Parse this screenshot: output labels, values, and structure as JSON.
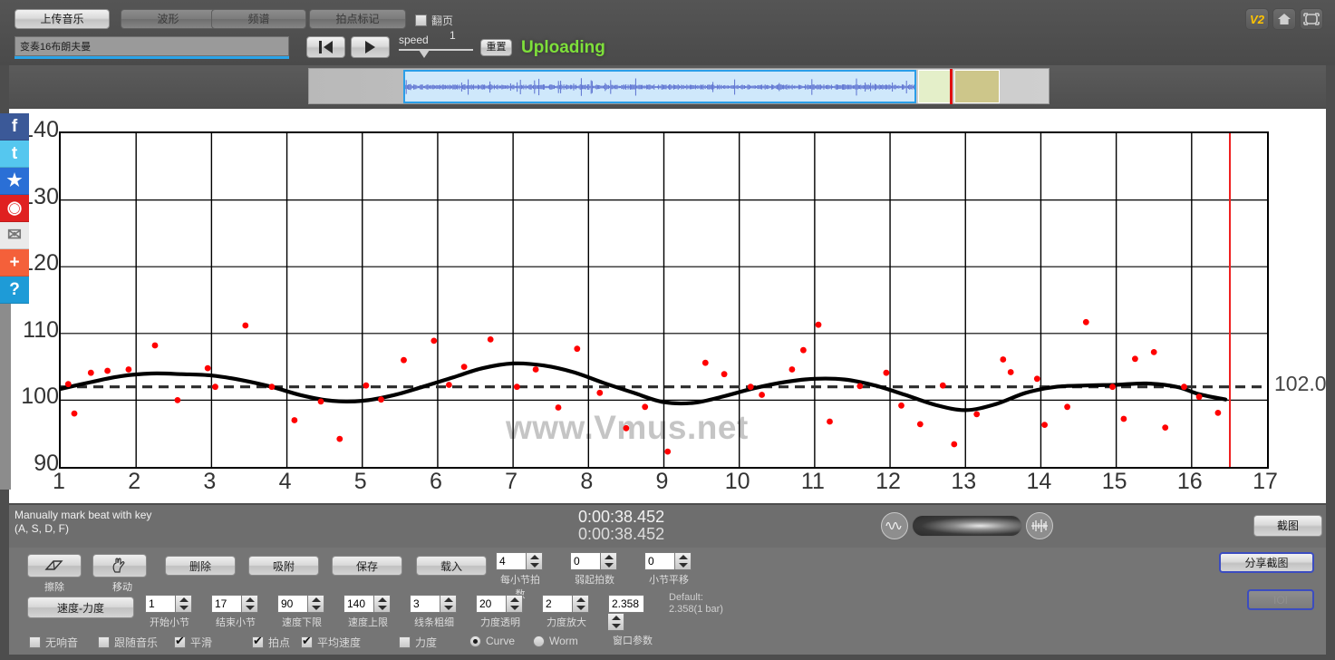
{
  "toolbar": {
    "upload_music": "上传音乐",
    "waveform": "波形",
    "spectrum": "频谱",
    "beat_mark": "拍点标记",
    "page_turn_label": "翻页",
    "page_turn_checked": false,
    "track_title": "变奏16布朗夫曼",
    "speed_label": "speed",
    "speed_value": "1",
    "reset": "重置",
    "status": "Uploading",
    "status_color": "#7ee03a",
    "version_badge": "V2",
    "home_icon": "home-icon",
    "fullscreen_icon": "fullscreen-icon"
  },
  "social": [
    {
      "name": "facebook-icon",
      "glyph": "f",
      "color": "#3b5998"
    },
    {
      "name": "twitter-icon",
      "glyph": "t",
      "color": "#55c7ef"
    },
    {
      "name": "qzone-icon",
      "glyph": "★",
      "color": "#2a6fd6"
    },
    {
      "name": "weibo-icon",
      "glyph": "◉",
      "color": "#e02020"
    },
    {
      "name": "email-icon",
      "glyph": "✉",
      "color": "#eaeaea"
    },
    {
      "name": "more-share-icon",
      "glyph": "+",
      "color": "#f4603a"
    },
    {
      "name": "help-icon",
      "glyph": "?",
      "color": "#1e9bd7"
    }
  ],
  "status_bar": {
    "hint_line1": "Manually mark beat with key",
    "hint_line2": "(A, S, D, F)",
    "time_current": "0:00:38.452",
    "time_total": "0:00:38.452",
    "screenshot": "截图"
  },
  "tools": {
    "erase": "擦除",
    "move": "移动",
    "delete": "删除",
    "snap": "吸附",
    "save": "保存",
    "load": "载入",
    "tempo_dynamics": "速度-力度",
    "share_screenshot": "分享截图",
    "ioi": "IOI"
  },
  "spinners_row1": [
    {
      "label": "每小节拍数",
      "value": "4"
    },
    {
      "label": "弱起拍数",
      "value": "0"
    },
    {
      "label": "小节平移",
      "value": "0"
    }
  ],
  "spinners_row2": [
    {
      "label": "开始小节",
      "value": "1"
    },
    {
      "label": "结束小节",
      "value": "17"
    },
    {
      "label": "速度下限",
      "value": "90"
    },
    {
      "label": "速度上限",
      "value": "140"
    },
    {
      "label": "线条粗细",
      "value": "3"
    },
    {
      "label": "力度透明",
      "value": "20"
    },
    {
      "label": "力度放大",
      "value": "2"
    },
    {
      "label": "窗口参数",
      "value": "2.358"
    }
  ],
  "default_note": {
    "line1": "Default:",
    "line2": "2.358(1 bar)"
  },
  "checkboxes": [
    {
      "label": "无响音",
      "checked": false
    },
    {
      "label": "跟随音乐",
      "checked": false
    },
    {
      "label": "平滑",
      "checked": true
    },
    {
      "label": "拍点",
      "checked": true
    },
    {
      "label": "平均速度",
      "checked": true
    },
    {
      "label": "力度",
      "checked": false
    }
  ],
  "radios": [
    {
      "label": "Curve",
      "selected": true
    },
    {
      "label": "Worm",
      "selected": false
    }
  ],
  "watermark": "www.Vmus.net",
  "chart_data": {
    "type": "scatter",
    "title": "",
    "xlabel": "",
    "ylabel": "",
    "xlim": [
      1,
      17
    ],
    "ylim": [
      90,
      140
    ],
    "xticks": [
      1,
      2,
      3,
      4,
      5,
      6,
      7,
      8,
      9,
      10,
      11,
      12,
      13,
      14,
      15,
      16,
      17
    ],
    "yticks": [
      90,
      100,
      110,
      120,
      130,
      140
    ],
    "grid": true,
    "average_line": {
      "value": 102.0,
      "label": "102.0",
      "style": "dashed"
    },
    "cursor_x": 16.5,
    "point_color": "#ff0000",
    "curve_color": "#000000",
    "series": [
      {
        "name": "beat tempo points",
        "type": "scatter",
        "points": [
          [
            1.1,
            102.4
          ],
          [
            1.18,
            98.0
          ],
          [
            1.4,
            104.1
          ],
          [
            1.62,
            104.4
          ],
          [
            1.9,
            104.6
          ],
          [
            2.25,
            108.2
          ],
          [
            2.55,
            100.0
          ],
          [
            2.95,
            104.8
          ],
          [
            3.05,
            102.0
          ],
          [
            3.45,
            111.2
          ],
          [
            3.8,
            102.0
          ],
          [
            4.1,
            97.0
          ],
          [
            4.45,
            99.8
          ],
          [
            4.7,
            94.2
          ],
          [
            5.05,
            102.2
          ],
          [
            5.25,
            100.1
          ],
          [
            5.55,
            106.0
          ],
          [
            5.95,
            108.9
          ],
          [
            6.15,
            102.3
          ],
          [
            6.35,
            105.0
          ],
          [
            6.7,
            109.1
          ],
          [
            7.05,
            102.0
          ],
          [
            7.3,
            104.6
          ],
          [
            7.6,
            98.9
          ],
          [
            7.85,
            107.7
          ],
          [
            8.15,
            101.1
          ],
          [
            8.5,
            95.8
          ],
          [
            8.75,
            99.0
          ],
          [
            9.05,
            92.3
          ],
          [
            9.55,
            105.6
          ],
          [
            9.8,
            103.9
          ],
          [
            10.15,
            102.0
          ],
          [
            10.3,
            100.8
          ],
          [
            10.7,
            104.6
          ],
          [
            10.85,
            107.5
          ],
          [
            11.05,
            111.3
          ],
          [
            11.2,
            96.8
          ],
          [
            11.6,
            102.1
          ],
          [
            11.95,
            104.1
          ],
          [
            12.15,
            99.2
          ],
          [
            12.4,
            96.4
          ],
          [
            12.7,
            102.2
          ],
          [
            12.85,
            93.4
          ],
          [
            13.15,
            97.9
          ],
          [
            13.5,
            106.1
          ],
          [
            13.6,
            104.2
          ],
          [
            13.95,
            103.2
          ],
          [
            14.05,
            96.3
          ],
          [
            14.35,
            99.0
          ],
          [
            14.6,
            111.7
          ],
          [
            14.95,
            102.0
          ],
          [
            15.1,
            97.2
          ],
          [
            15.25,
            106.2
          ],
          [
            15.5,
            107.2
          ],
          [
            15.65,
            95.9
          ],
          [
            15.9,
            102.0
          ],
          [
            16.1,
            100.5
          ],
          [
            16.35,
            98.1
          ]
        ]
      },
      {
        "name": "smoothed tempo curve",
        "type": "line",
        "points": [
          [
            1.0,
            101.7
          ],
          [
            1.4,
            102.7
          ],
          [
            1.8,
            103.6
          ],
          [
            2.2,
            104.0
          ],
          [
            2.6,
            103.9
          ],
          [
            3.0,
            103.7
          ],
          [
            3.4,
            103.0
          ],
          [
            3.8,
            102.0
          ],
          [
            4.2,
            100.7
          ],
          [
            4.6,
            99.9
          ],
          [
            5.0,
            99.9
          ],
          [
            5.4,
            100.7
          ],
          [
            5.8,
            102.0
          ],
          [
            6.2,
            103.4
          ],
          [
            6.6,
            104.8
          ],
          [
            7.0,
            105.5
          ],
          [
            7.4,
            105.2
          ],
          [
            7.8,
            104.2
          ],
          [
            8.2,
            102.6
          ],
          [
            8.6,
            101.1
          ],
          [
            9.0,
            99.7
          ],
          [
            9.4,
            99.6
          ],
          [
            9.8,
            100.6
          ],
          [
            10.2,
            101.8
          ],
          [
            10.6,
            102.7
          ],
          [
            11.0,
            103.2
          ],
          [
            11.4,
            103.1
          ],
          [
            11.8,
            102.2
          ],
          [
            12.2,
            100.8
          ],
          [
            12.6,
            99.3
          ],
          [
            13.0,
            98.5
          ],
          [
            13.4,
            99.4
          ],
          [
            13.8,
            101.1
          ],
          [
            14.2,
            102.0
          ],
          [
            14.6,
            102.2
          ],
          [
            15.0,
            102.3
          ],
          [
            15.4,
            102.5
          ],
          [
            15.8,
            102.0
          ],
          [
            16.1,
            100.9
          ],
          [
            16.45,
            100.1
          ]
        ]
      }
    ]
  }
}
